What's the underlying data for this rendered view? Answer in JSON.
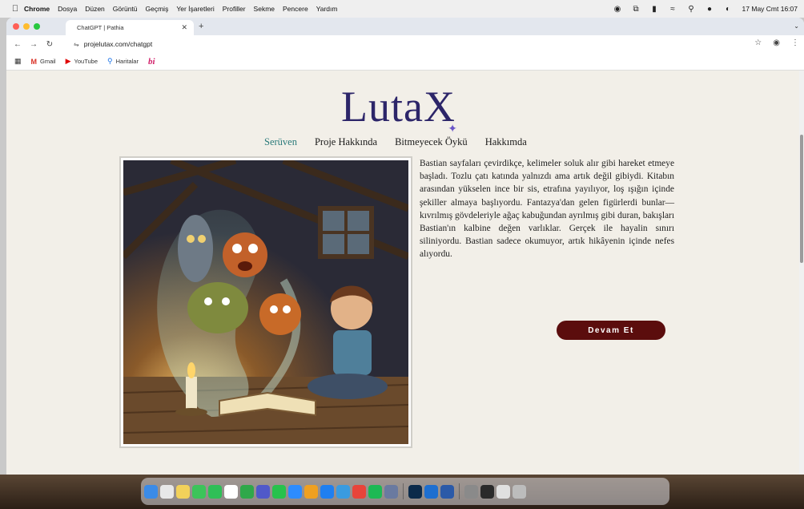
{
  "menubar": {
    "app_name": "Chrome",
    "items": [
      "Dosya",
      "Düzen",
      "Görüntü",
      "Geçmiş",
      "Yer İşaretleri",
      "Profiller",
      "Sekme",
      "Pencere",
      "Yardım"
    ],
    "clock": "17 May Cmt 16:07"
  },
  "browser": {
    "tab_title": "ChatGPT | Pathia",
    "url": "projelutax.com/chatgpt",
    "bookmarks": [
      {
        "label": "Gmail",
        "icon": "gmail-icon",
        "color": "#d93025"
      },
      {
        "label": "YouTube",
        "icon": "youtube-icon",
        "color": "#e00000"
      },
      {
        "label": "Haritalar",
        "icon": "maps-icon",
        "color": "#1a73e8"
      },
      {
        "label": "bi",
        "icon": "bi-icon",
        "color": "#d11f69"
      }
    ]
  },
  "site": {
    "logo": "LutaX",
    "nav": [
      {
        "label": "Serüven",
        "active": true
      },
      {
        "label": "Proje Hakkında",
        "active": false
      },
      {
        "label": "Bitmeyecek Öykü",
        "active": false
      },
      {
        "label": "Hakkımda",
        "active": false
      }
    ],
    "story": "Bastian sayfaları çevirdikçe, kelimeler soluk alır gibi hareket etmeye başladı. Tozlu çatı katında yalnızdı ama artık değil gibiydi. Kitabın arasından yükselen ince bir sis, etrafına yayılıyor, loş ışığın içinde şekiller almaya başlıyordu. Fantazya'dan gelen figürlerdi bunlar—kıvrılmış gövdeleriyle ağaç kabuğundan ayrılmış gibi duran, bakışları Bastian'ın kalbine değen varlıklar. Gerçek ile hayalin sınırı siliniyordu. Bastian sadece okumuyor, artık hikâyenin içinde nefes alıyordu.",
    "button_label": "Devam Et",
    "accent_color": "#5b0d0d",
    "nav_active_color": "#2a7a7a"
  },
  "dock": {
    "apps": [
      "finder-icon",
      "launchpad-icon",
      "notes-icon",
      "messages-icon",
      "facetime-icon",
      "calendar-icon",
      "numbers-icon",
      "teams-icon",
      "whatsapp-icon",
      "zoom-icon",
      "pages-icon",
      "appstore-icon",
      "safari-icon",
      "chrome-icon",
      "spotify-icon",
      "preview-icon",
      "photoshop-icon",
      "outlook-icon",
      "word-icon",
      "help-icon",
      "photos-icon",
      "folder-icon",
      "trash-icon"
    ]
  }
}
